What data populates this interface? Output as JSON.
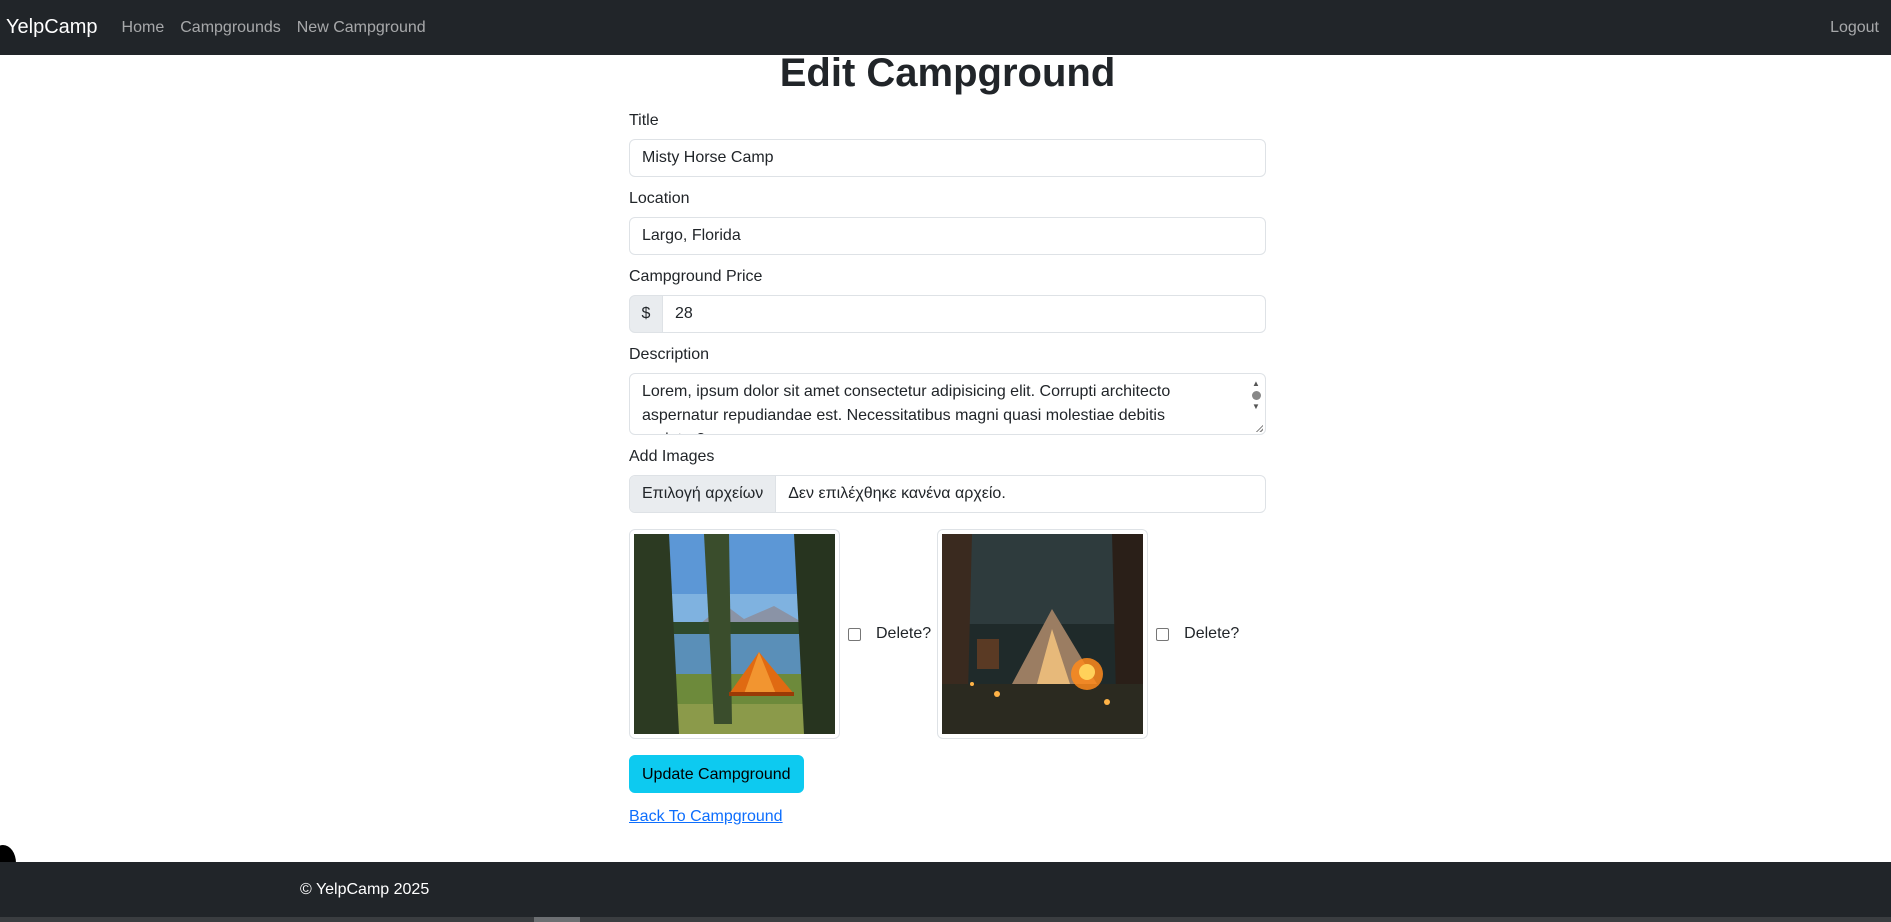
{
  "nav": {
    "brand": "YelpCamp",
    "links": [
      "Home",
      "Campgrounds",
      "New Campground"
    ],
    "logout": "Logout"
  },
  "form": {
    "page_title": "Edit Campground",
    "title_label": "Title",
    "title_value": "Misty Horse Camp",
    "location_label": "Location",
    "location_value": "Largo, Florida",
    "price_label": "Campground Price",
    "price_addon": "$",
    "price_value": "28",
    "description_label": "Description",
    "description_value": "Lorem, ipsum dolor sit amet consectetur adipisicing elit. Corrupti architecto aspernatur repudiandae est. Necessitatibus magni quasi molestiae debitis pariatur?",
    "images_label": "Add Images",
    "file_button": "Επιλογή αρχείων",
    "file_status": "Δεν επιλέχθηκε κανένα αρχείο.",
    "images": [
      {
        "delete_label": "Delete?",
        "checked": false
      },
      {
        "delete_label": "Delete?",
        "checked": false
      }
    ],
    "submit_label": "Update Campground",
    "back_link": "Back To Campground"
  },
  "footer": {
    "text": "© YelpCamp 2025"
  },
  "colors": {
    "navbar_bg": "#212529",
    "accent_button": "#0dcaf0",
    "link": "#0d6efd"
  }
}
